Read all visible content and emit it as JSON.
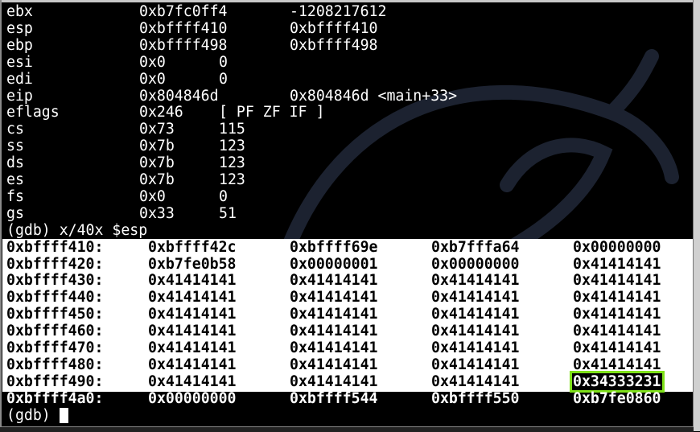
{
  "registers": [
    {
      "name": "ebx",
      "hex": "0xb7fc0ff4",
      "natural": "-1208217612"
    },
    {
      "name": "esp",
      "hex": "0xbffff410",
      "natural": "0xbffff410"
    },
    {
      "name": "ebp",
      "hex": "0xbffff498",
      "natural": "0xbffff498"
    },
    {
      "name": "esi",
      "hex": "0x0",
      "natural": "0"
    },
    {
      "name": "edi",
      "hex": "0x0",
      "natural": "0"
    },
    {
      "name": "eip",
      "hex": "0x804846d",
      "natural": "0x804846d <main+33>"
    },
    {
      "name": "eflags",
      "hex": "0x246",
      "natural": "[ PF ZF IF ]"
    },
    {
      "name": "cs",
      "hex": "0x73",
      "natural": "115"
    },
    {
      "name": "ss",
      "hex": "0x7b",
      "natural": "123"
    },
    {
      "name": "ds",
      "hex": "0x7b",
      "natural": "123"
    },
    {
      "name": "es",
      "hex": "0x7b",
      "natural": "123"
    },
    {
      "name": "fs",
      "hex": "0x0",
      "natural": "0"
    },
    {
      "name": "gs",
      "hex": "0x33",
      "natural": "51"
    }
  ],
  "command": "(gdb) x/40x $esp",
  "memory": [
    {
      "addr": "0xbffff410:",
      "words": [
        "0xbffff42c",
        "0xbffff69e",
        "0xb7fffa64",
        "0x00000000"
      ]
    },
    {
      "addr": "0xbffff420:",
      "words": [
        "0xb7fe0b58",
        "0x00000001",
        "0x00000000",
        "0x41414141"
      ]
    },
    {
      "addr": "0xbffff430:",
      "words": [
        "0x41414141",
        "0x41414141",
        "0x41414141",
        "0x41414141"
      ]
    },
    {
      "addr": "0xbffff440:",
      "words": [
        "0x41414141",
        "0x41414141",
        "0x41414141",
        "0x41414141"
      ]
    },
    {
      "addr": "0xbffff450:",
      "words": [
        "0x41414141",
        "0x41414141",
        "0x41414141",
        "0x41414141"
      ]
    },
    {
      "addr": "0xbffff460:",
      "words": [
        "0x41414141",
        "0x41414141",
        "0x41414141",
        "0x41414141"
      ]
    },
    {
      "addr": "0xbffff470:",
      "words": [
        "0x41414141",
        "0x41414141",
        "0x41414141",
        "0x41414141"
      ]
    },
    {
      "addr": "0xbffff480:",
      "words": [
        "0x41414141",
        "0x41414141",
        "0x41414141",
        "0x41414141"
      ]
    },
    {
      "addr": "0xbffff490:",
      "words": [
        "0x41414141",
        "0x41414141",
        "0x41414141",
        "0x34333231"
      ]
    },
    {
      "addr": "0xbffff4a0:",
      "words": [
        "0x00000000",
        "0xbffff544",
        "0xbffff550",
        "0xb7fe0860"
      ]
    }
  ],
  "prompt": "(gdb) ",
  "colors": {
    "highlight_box": "#7fe11a",
    "selection": "#ffffff",
    "background": "#000000"
  }
}
